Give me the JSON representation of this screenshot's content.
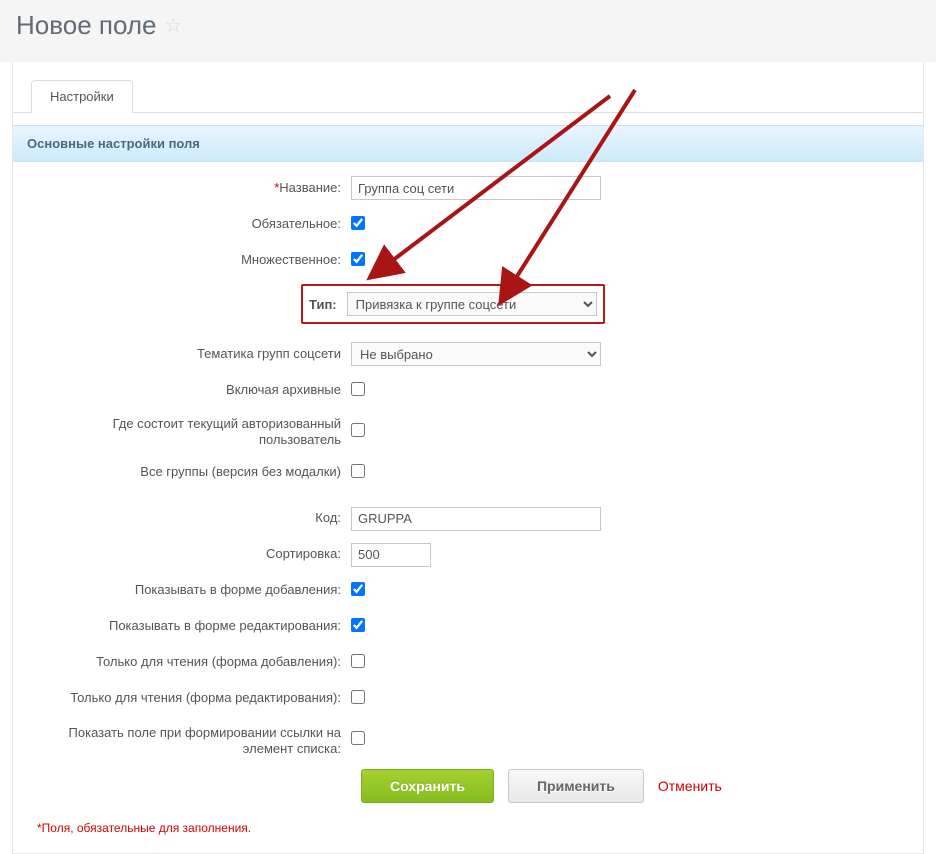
{
  "page": {
    "title": "Новое поле"
  },
  "tabs": {
    "settings": "Настройки"
  },
  "section": {
    "title": "Основные настройки поля"
  },
  "form": {
    "name_label": "Название:",
    "name_value": "Группа соц сети",
    "required_label": "Обязательное:",
    "required_checked": true,
    "multiple_label": "Множественное:",
    "multiple_checked": true,
    "type_label": "Тип:",
    "type_value": "Привязка к группе соцсети",
    "topic_label": "Тематика групп соцсети",
    "topic_value": "Не выбрано",
    "archived_label": "Включая архивные",
    "archived_checked": false,
    "authuser_label": "Где состоит текущий авторизованный пользователь",
    "authuser_checked": false,
    "nomodal_label": "Все группы (версия без модалки)",
    "nomodal_checked": false,
    "code_label": "Код:",
    "code_value": "GRUPPA",
    "sort_label": "Сортировка:",
    "sort_value": "500",
    "show_add_label": "Показывать в форме добавления:",
    "show_add_checked": true,
    "show_edit_label": "Показывать в форме редактирования:",
    "show_edit_checked": true,
    "ro_add_label": "Только для чтения (форма добавления):",
    "ro_add_checked": false,
    "ro_edit_label": "Только для чтения (форма редактирования):",
    "ro_edit_checked": false,
    "show_link_label": "Показать поле при формировании ссылки на элемент списка:",
    "show_link_checked": false
  },
  "buttons": {
    "save": "Сохранить",
    "apply": "Применить",
    "cancel": "Отменить"
  },
  "footnote": "*Поля, обязательные для заполнения."
}
